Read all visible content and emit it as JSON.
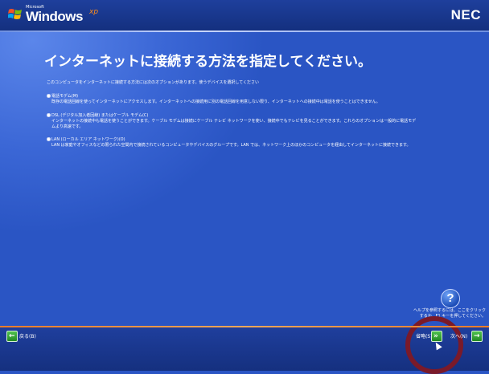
{
  "header": {
    "brand_small": "Microsoft",
    "brand": "Windows",
    "brand_suffix": "xp",
    "vendor": "NEC"
  },
  "main": {
    "title": "インターネットに接続する方法を指定してください。",
    "intro": "このコンピュータをインターネットに接続する方法には次のオプションがあります。使うデバイスを選択してください",
    "options": [
      {
        "label": "電話モデム(M)",
        "desc": "既存の電話回線を使ってインターネットにアクセスします。インターネットへの接続用に別の電話回線を用意しない限り、インターネットへの接続中は電話を使うことはできません。",
        "desc2": ""
      },
      {
        "label": "DSL (デジタル加入者回線) またはケーブル モデム(C)",
        "desc": "インターネットの接続中も電話を使うことができます。ケーブル モデムは接続にケーブル テレビ ネットワークを使い、接続中でもテレビを見ることができます。これらのオプションは一般的に電話モデ",
        "desc2": "ムより高速です。"
      },
      {
        "label": "LAN (ローカル エリア ネットワーク)(O)",
        "desc": "LAN は家庭やオフィスなどの限られた空間内で接続されているコンピュータやデバイスのグループです。LAN では、ネットワーク上のほかのコンピュータを経由してインターネットに接続できます。",
        "desc2": ""
      }
    ],
    "help_symbol": "?",
    "help_line1": "ヘルプを参照するには、ここをクリック",
    "help_line2": "するか、F1 キーを押してください。"
  },
  "footer": {
    "back_label": "戻る(B)",
    "skip_label": "省略(S)",
    "next_label": "次へ(N)"
  },
  "colors": {
    "background": "#2a55c4",
    "header": "#14307f",
    "accent_line": "#e87b2a",
    "nav_button": "#2fa52f",
    "highlight_ring": "#7a1a2a"
  }
}
